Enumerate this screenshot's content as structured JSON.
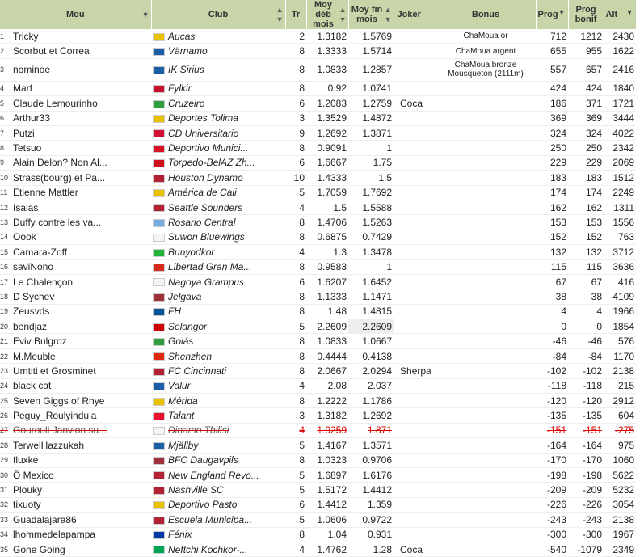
{
  "headers": {
    "mou": "Mou",
    "club": "Club",
    "tr": "Tr",
    "moy_deb": "Moy déb mois",
    "moy_fin": "Moy fin mois",
    "joker": "Joker",
    "bonus": "Bonus",
    "prog": "Prog",
    "prog_bonif": "Prog bonif",
    "alt": "Alt"
  },
  "rows": [
    {
      "n": "1",
      "mou": "Tricky",
      "flag": "#e8c200",
      "club": "Aucas",
      "tr": "2",
      "deb": "1.3182",
      "fin": "1.5769",
      "joker": "",
      "bonus": "ChaMoua or",
      "prog": "712",
      "bonif": "1212",
      "alt": "2430"
    },
    {
      "n": "2",
      "mou": "Scorbut et Correa",
      "flag": "#1a5fa8",
      "club": "Värnamo",
      "tr": "8",
      "deb": "1.3333",
      "fin": "1.5714",
      "joker": "",
      "bonus": "ChaMoua argent",
      "prog": "655",
      "bonif": "955",
      "alt": "1622"
    },
    {
      "n": "3",
      "mou": "nominoe",
      "flag": "#1a5fa8",
      "club": "IK Sirius",
      "tr": "8",
      "deb": "1.0833",
      "fin": "1.2857",
      "joker": "",
      "bonus": "ChaMoua bronze Mousqueton (2111m)",
      "prog": "557",
      "bonif": "657",
      "alt": "2416"
    },
    {
      "n": "4",
      "mou": "Marf",
      "flag": "#c8102e",
      "club": "Fylkir",
      "tr": "8",
      "deb": "0.92",
      "fin": "1.0741",
      "joker": "",
      "bonus": "",
      "prog": "424",
      "bonif": "424",
      "alt": "1840"
    },
    {
      "n": "5",
      "mou": "Claude Lemourinho",
      "flag": "#2e9e3f",
      "club": "Cruzeiro",
      "tr": "6",
      "deb": "1.2083",
      "fin": "1.2759",
      "joker": "Coca",
      "bonus": "",
      "prog": "186",
      "bonif": "371",
      "alt": "1721"
    },
    {
      "n": "6",
      "mou": "Arthur33",
      "flag": "#e8c200",
      "club": "Deportes Tolima",
      "tr": "3",
      "deb": "1.3529",
      "fin": "1.4872",
      "joker": "",
      "bonus": "",
      "prog": "369",
      "bonif": "369",
      "alt": "3444"
    },
    {
      "n": "7",
      "mou": "Putzi",
      "flag": "#d21034",
      "club": "CD Universitario",
      "tr": "9",
      "deb": "1.2692",
      "fin": "1.3871",
      "joker": "",
      "bonus": "",
      "prog": "324",
      "bonif": "324",
      "alt": "4022"
    },
    {
      "n": "8",
      "mou": "Tetsuo",
      "flag": "#d91023",
      "club": "Deportivo Munici...",
      "tr": "8",
      "deb": "0.9091",
      "fin": "1",
      "joker": "",
      "bonus": "",
      "prog": "250",
      "bonif": "250",
      "alt": "2342"
    },
    {
      "n": "9",
      "mou": "Alain Delon? Non Al...",
      "flag": "#cf101a",
      "club": "Torpedo-BelAZ Zh...",
      "tr": "6",
      "deb": "1.6667",
      "fin": "1.75",
      "joker": "",
      "bonus": "",
      "prog": "229",
      "bonif": "229",
      "alt": "2069"
    },
    {
      "n": "10",
      "mou": "Strass(bourg) et Pa...",
      "flag": "#b22234",
      "club": "Houston Dynamo",
      "tr": "10",
      "deb": "1.4333",
      "fin": "1.5",
      "joker": "",
      "bonus": "",
      "prog": "183",
      "bonif": "183",
      "alt": "1512"
    },
    {
      "n": "11",
      "mou": "Etienne Mattler",
      "flag": "#e8c200",
      "club": "América de Cali",
      "tr": "5",
      "deb": "1.7059",
      "fin": "1.7692",
      "joker": "",
      "bonus": "",
      "prog": "174",
      "bonif": "174",
      "alt": "2249"
    },
    {
      "n": "12",
      "mou": "Isaias",
      "flag": "#b22234",
      "club": "Seattle Sounders",
      "tr": "4",
      "deb": "1.5",
      "fin": "1.5588",
      "joker": "",
      "bonus": "",
      "prog": "162",
      "bonif": "162",
      "alt": "1311"
    },
    {
      "n": "13",
      "mou": "Duffy contre les va...",
      "flag": "#74acdf",
      "club": "Rosario Central",
      "tr": "8",
      "deb": "1.4706",
      "fin": "1.5263",
      "joker": "",
      "bonus": "",
      "prog": "153",
      "bonif": "153",
      "alt": "1556"
    },
    {
      "n": "14",
      "mou": "Oook",
      "flag": "#f4f4f4",
      "club": "Suwon Bluewings",
      "tr": "8",
      "deb": "0.6875",
      "fin": "0.7429",
      "joker": "",
      "bonus": "",
      "prog": "152",
      "bonif": "152",
      "alt": "763"
    },
    {
      "n": "15",
      "mou": "Camara-Zoff",
      "flag": "#1eb53a",
      "club": "Bunyodkor",
      "tr": "4",
      "deb": "1.3",
      "fin": "1.3478",
      "joker": "",
      "bonus": "",
      "prog": "132",
      "bonif": "132",
      "alt": "3712"
    },
    {
      "n": "16",
      "mou": "saviNono",
      "flag": "#d52b1e",
      "club": "Libertad Gran Ma...",
      "tr": "8",
      "deb": "0.9583",
      "fin": "1",
      "joker": "",
      "bonus": "",
      "prog": "115",
      "bonif": "115",
      "alt": "3636"
    },
    {
      "n": "17",
      "mou": "Le Chalençon",
      "flag": "#f4f4f4",
      "club": "Nagoya Grampus",
      "tr": "6",
      "deb": "1.6207",
      "fin": "1.6452",
      "joker": "",
      "bonus": "",
      "prog": "67",
      "bonif": "67",
      "alt": "416"
    },
    {
      "n": "18",
      "mou": "D Sychev",
      "flag": "#9e3039",
      "club": "Jelgava",
      "tr": "8",
      "deb": "1.1333",
      "fin": "1.1471",
      "joker": "",
      "bonus": "",
      "prog": "38",
      "bonif": "38",
      "alt": "4109"
    },
    {
      "n": "19",
      "mou": "Zeusvds",
      "flag": "#02529c",
      "club": "FH",
      "tr": "8",
      "deb": "1.48",
      "fin": "1.4815",
      "joker": "",
      "bonus": "",
      "prog": "4",
      "bonif": "4",
      "alt": "1966"
    },
    {
      "n": "20",
      "mou": "bendjaz",
      "flag": "#cc0001",
      "club": "Selangor",
      "tr": "5",
      "deb": "2.2609",
      "fin": "2.2609",
      "joker": "",
      "bonus": "",
      "prog": "0",
      "bonif": "0",
      "alt": "1854"
    },
    {
      "n": "21",
      "mou": "Eviv Bulgroz",
      "flag": "#2e9e3f",
      "club": "Goiás",
      "tr": "8",
      "deb": "1.0833",
      "fin": "1.0667",
      "joker": "",
      "bonus": "",
      "prog": "-46",
      "bonif": "-46",
      "alt": "576"
    },
    {
      "n": "22",
      "mou": "M.Meuble",
      "flag": "#de2910",
      "club": "Shenzhen",
      "tr": "8",
      "deb": "0.4444",
      "fin": "0.4138",
      "joker": "",
      "bonus": "",
      "prog": "-84",
      "bonif": "-84",
      "alt": "1170"
    },
    {
      "n": "23",
      "mou": "Umtiti et Grosminet",
      "flag": "#b22234",
      "club": "FC Cincinnati",
      "tr": "8",
      "deb": "2.0667",
      "fin": "2.0294",
      "joker": "Sherpa",
      "bonus": "",
      "prog": "-102",
      "bonif": "-102",
      "alt": "2138"
    },
    {
      "n": "24",
      "mou": "black cat",
      "flag": "#1a5fa8",
      "club": "Valur",
      "tr": "4",
      "deb": "2.08",
      "fin": "2.037",
      "joker": "",
      "bonus": "",
      "prog": "-118",
      "bonif": "-118",
      "alt": "215"
    },
    {
      "n": "25",
      "mou": "Seven Giggs of Rhye",
      "flag": "#e8c200",
      "club": "Mérida",
      "tr": "8",
      "deb": "1.2222",
      "fin": "1.1786",
      "joker": "",
      "bonus": "",
      "prog": "-120",
      "bonif": "-120",
      "alt": "2912"
    },
    {
      "n": "26",
      "mou": "Peguy_Roulyindula",
      "flag": "#e8112d",
      "club": "Talant",
      "tr": "3",
      "deb": "1.3182",
      "fin": "1.2692",
      "joker": "",
      "bonus": "",
      "prog": "-135",
      "bonif": "-135",
      "alt": "604"
    },
    {
      "n": "27",
      "mou": "Gourouli Janvion su...",
      "flag": "#f4f4f4",
      "club": "Dinamo Tbilisi",
      "tr": "4",
      "deb": "1.9259",
      "fin": "1.871",
      "joker": "",
      "bonus": "",
      "prog": "-151",
      "bonif": "-151",
      "alt": "-275",
      "struck": true
    },
    {
      "n": "28",
      "mou": "TerwelHazzukah",
      "flag": "#1a5fa8",
      "club": "Mjällby",
      "tr": "5",
      "deb": "1.4167",
      "fin": "1.3571",
      "joker": "",
      "bonus": "",
      "prog": "-164",
      "bonif": "-164",
      "alt": "975"
    },
    {
      "n": "29",
      "mou": "fluxke",
      "flag": "#9e3039",
      "club": "BFC Daugavpils",
      "tr": "8",
      "deb": "1.0323",
      "fin": "0.9706",
      "joker": "",
      "bonus": "",
      "prog": "-170",
      "bonif": "-170",
      "alt": "1060"
    },
    {
      "n": "30",
      "mou": "Ô Mexico",
      "flag": "#b22234",
      "club": "New England Revo...",
      "tr": "5",
      "deb": "1.6897",
      "fin": "1.6176",
      "joker": "",
      "bonus": "",
      "prog": "-198",
      "bonif": "-198",
      "alt": "5622"
    },
    {
      "n": "31",
      "mou": "Plouky",
      "flag": "#b22234",
      "club": "Nashville SC",
      "tr": "5",
      "deb": "1.5172",
      "fin": "1.4412",
      "joker": "",
      "bonus": "",
      "prog": "-209",
      "bonif": "-209",
      "alt": "5232"
    },
    {
      "n": "32",
      "mou": "tixuoty",
      "flag": "#e8c200",
      "club": "Deportivo Pasto",
      "tr": "6",
      "deb": "1.4412",
      "fin": "1.359",
      "joker": "",
      "bonus": "",
      "prog": "-226",
      "bonif": "-226",
      "alt": "3054"
    },
    {
      "n": "33",
      "mou": "Guadalajara86",
      "flag": "#b22234",
      "club": "Escuela Municipa...",
      "tr": "5",
      "deb": "1.0606",
      "fin": "0.9722",
      "joker": "",
      "bonus": "",
      "prog": "-243",
      "bonif": "-243",
      "alt": "2138"
    },
    {
      "n": "34",
      "mou": "lhommedelapampa",
      "flag": "#0038a8",
      "club": "Fénix",
      "tr": "8",
      "deb": "1.04",
      "fin": "0.931",
      "joker": "",
      "bonus": "",
      "prog": "-300",
      "bonif": "-300",
      "alt": "1967"
    },
    {
      "n": "35",
      "mou": "Gone Going",
      "flag": "#00a651",
      "club": "Neftchi Kochkor-...",
      "tr": "4",
      "deb": "1.4762",
      "fin": "1.28",
      "joker": "Coca",
      "bonus": "",
      "prog": "-540",
      "bonif": "-1079",
      "alt": "2349"
    }
  ]
}
